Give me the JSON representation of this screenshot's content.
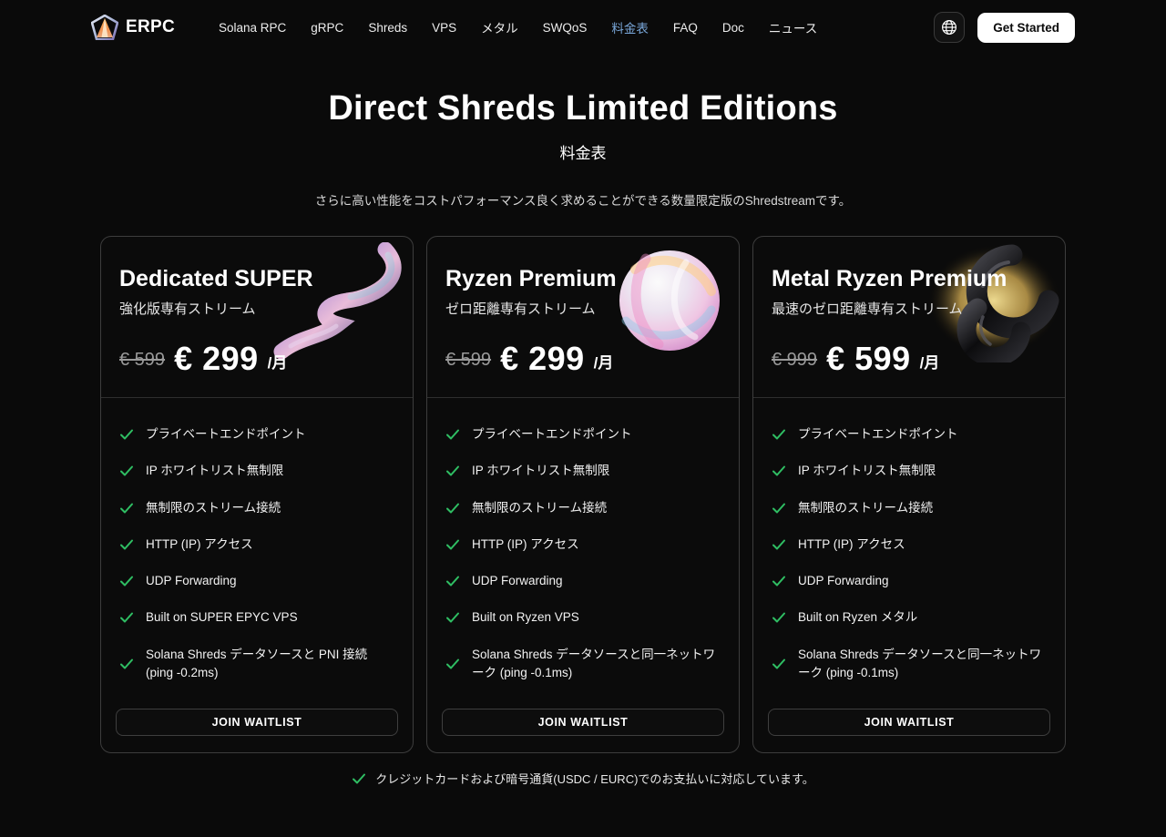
{
  "nav": {
    "brand": "ERPC",
    "items": [
      {
        "label": "Solana RPC",
        "active": false
      },
      {
        "label": "gRPC",
        "active": false
      },
      {
        "label": "Shreds",
        "active": false
      },
      {
        "label": "VPS",
        "active": false
      },
      {
        "label": "メタル",
        "active": false
      },
      {
        "label": "SWQoS",
        "active": false
      },
      {
        "label": "料金表",
        "active": true
      },
      {
        "label": "FAQ",
        "active": false
      },
      {
        "label": "Doc",
        "active": false
      },
      {
        "label": "ニュース",
        "active": false
      }
    ],
    "language_icon": "globe-icon",
    "get_started_label": "Get Started"
  },
  "hero": {
    "title": "Direct Shreds Limited Editions",
    "subtitle": "料金表",
    "description": "さらに高い性能をコストパフォーマンス良く求めることができる数量限定版のShredstreamです。"
  },
  "plans": [
    {
      "name": "Dedicated SUPER",
      "tagline": "強化版専有ストリーム",
      "original_price": "€ 599",
      "price": "€ 299",
      "period": "/月",
      "art": "iridescent-swirl",
      "features": [
        "プライベートエンドポイント",
        "IP ホワイトリスト無制限",
        "無制限のストリーム接続",
        "HTTP (IP) アクセス",
        "UDP Forwarding",
        "Built on SUPER EPYC VPS",
        "Solana Shreds データソースと PNI 接続 (ping -0.2ms)"
      ],
      "cta": "JOIN WAITLIST"
    },
    {
      "name": "Ryzen Premium",
      "tagline": "ゼロ距離専有ストリーム",
      "original_price": "€ 599",
      "price": "€ 299",
      "period": "/月",
      "art": "pearlescent-orb",
      "features": [
        "プライベートエンドポイント",
        "IP ホワイトリスト無制限",
        "無制限のストリーム接続",
        "HTTP (IP) アクセス",
        "UDP Forwarding",
        "Built on Ryzen VPS",
        "Solana Shreds データソースと同一ネットワーク (ping -0.1ms)"
      ],
      "cta": "JOIN WAITLIST"
    },
    {
      "name": "Metal Ryzen Premium",
      "tagline": "最速のゼロ距離専有ストリーム",
      "original_price": "€ 999",
      "price": "€ 599",
      "period": "/月",
      "art": "dark-metal-rings",
      "features": [
        "プライベートエンドポイント",
        "IP ホワイトリスト無制限",
        "無制限のストリーム接続",
        "HTTP (IP) アクセス",
        "UDP Forwarding",
        "Built on Ryzen メタル",
        "Solana Shreds データソースと同一ネットワーク (ping -0.1ms)"
      ],
      "cta": "JOIN WAITLIST"
    }
  ],
  "footer": {
    "note": "クレジットカードおよび暗号通貨(USDC / EURC)でのお支払いに対応しています。"
  },
  "colors": {
    "background": "#0a0a0a",
    "card_background": "#0b0b0b",
    "card_border": "#3d3d3d",
    "active_nav": "#79a7d9",
    "check_green": "#2fbe63",
    "cta_button": "#ffffff"
  }
}
